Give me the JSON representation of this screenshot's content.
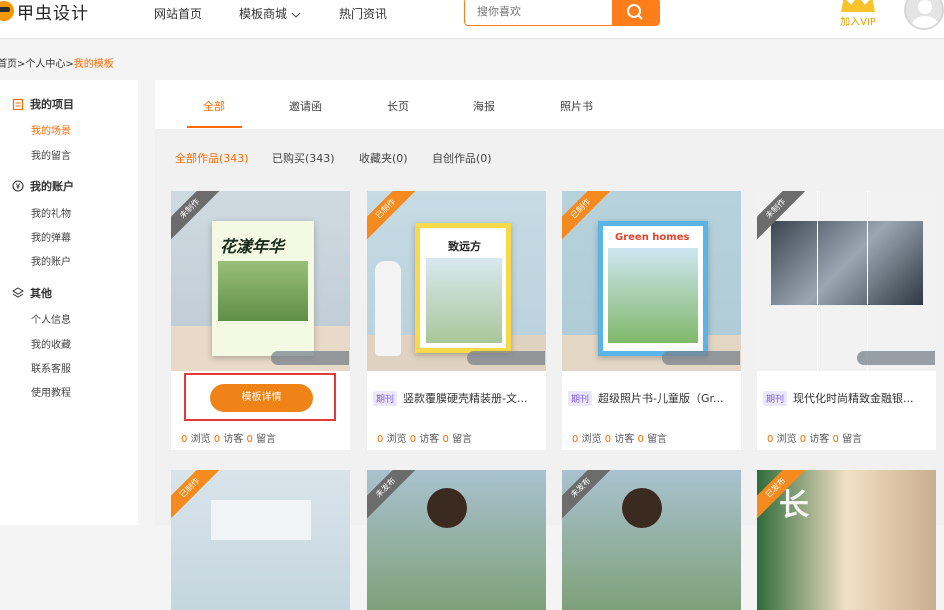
{
  "header": {
    "logo_text": "甲虫设计",
    "nav": [
      {
        "label": "网站首页"
      },
      {
        "label": "模板商城"
      },
      {
        "label": "热门资讯"
      }
    ],
    "search_placeholder": "搜你喜欢",
    "vip_label": "加入VIP",
    "vip_crown_text": "vip"
  },
  "breadcrumb": {
    "home": "首页",
    "sep1": ">",
    "center": "个人中心",
    "sep2": ">",
    "current": "我的模板"
  },
  "sidebar": {
    "groups": [
      {
        "title": "我的项目",
        "items": [
          "我的场景",
          "我的留言"
        ]
      },
      {
        "title": "我的账户",
        "items": [
          "我的礼物",
          "我的弹幕",
          "我的账户"
        ]
      },
      {
        "title": "其他",
        "items": [
          "个人信息",
          "我的收藏",
          "联系客服",
          "使用教程"
        ]
      }
    ]
  },
  "tabs": [
    "全部",
    "邀请函",
    "长页",
    "海报",
    "照片书"
  ],
  "filters": [
    "全部作品(343)",
    "已购买(343)",
    "收藏夹(0)",
    "自创作品(0)"
  ],
  "cards": [
    {
      "ribbon": "未制作",
      "book_title": "花漾年华",
      "detail_button": "模板详情",
      "stats": {
        "views": "0",
        "views_label": "浏览",
        "visitors": "0",
        "visitors_label": "访客",
        "comments": "0",
        "comments_label": "留言"
      }
    },
    {
      "ribbon": "已制作",
      "book_title": "致远方",
      "tag": "期刊",
      "title": "竖款覆膜硬壳精装册-文...",
      "stats": {
        "views": "0",
        "views_label": "浏览",
        "visitors": "0",
        "visitors_label": "访客",
        "comments": "0",
        "comments_label": "留言"
      }
    },
    {
      "ribbon": "已制作",
      "book_title": "Green homes",
      "tag": "期刊",
      "title": "超级照片书-儿童版（Gr...",
      "stats": {
        "views": "0",
        "views_label": "浏览",
        "visitors": "0",
        "visitors_label": "访客",
        "comments": "0",
        "comments_label": "留言"
      }
    },
    {
      "ribbon": "未制作",
      "tag": "期刊",
      "title": "现代化时尚精致金融银...",
      "stats": {
        "views": "0",
        "views_label": "浏览",
        "visitors": "0",
        "visitors_label": "访客",
        "comments": "0",
        "comments_label": "留言"
      }
    }
  ],
  "cards_row2": [
    {
      "ribbon": "已制作"
    },
    {
      "ribbon": "未发布"
    },
    {
      "ribbon": "未发布"
    },
    {
      "ribbon": "已发布",
      "overlay_text": "长"
    }
  ],
  "colors": {
    "accent": "#ff6a00",
    "button": "#f08318",
    "highlight_border": "#e03a3a"
  }
}
